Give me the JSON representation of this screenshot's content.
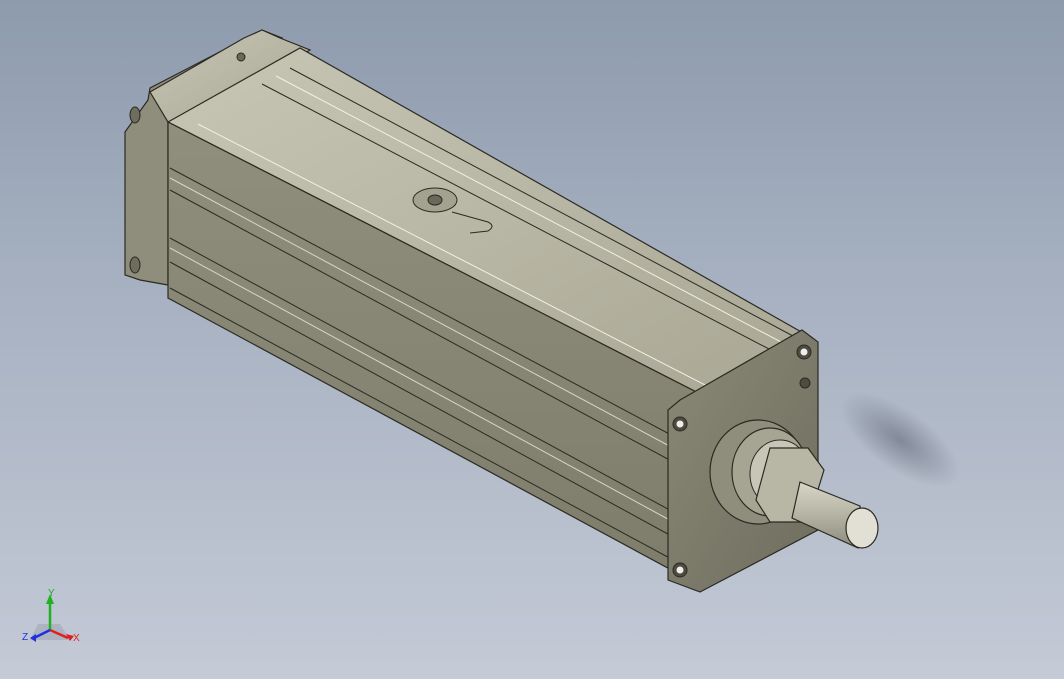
{
  "viewport": {
    "background_top": "#8e9bad",
    "background_bottom": "#c4cad6",
    "model": {
      "part_type": "pneumatic-cylinder",
      "body_color": "#9c9a88",
      "body_shade_color": "#7d7b6b",
      "rod_color": "#b9b7a8"
    }
  },
  "triad": {
    "x_label": "X",
    "y_label": "Y",
    "z_label": "Z",
    "x_color": "#e02020",
    "y_color": "#20b020",
    "z_color": "#2030e0"
  }
}
